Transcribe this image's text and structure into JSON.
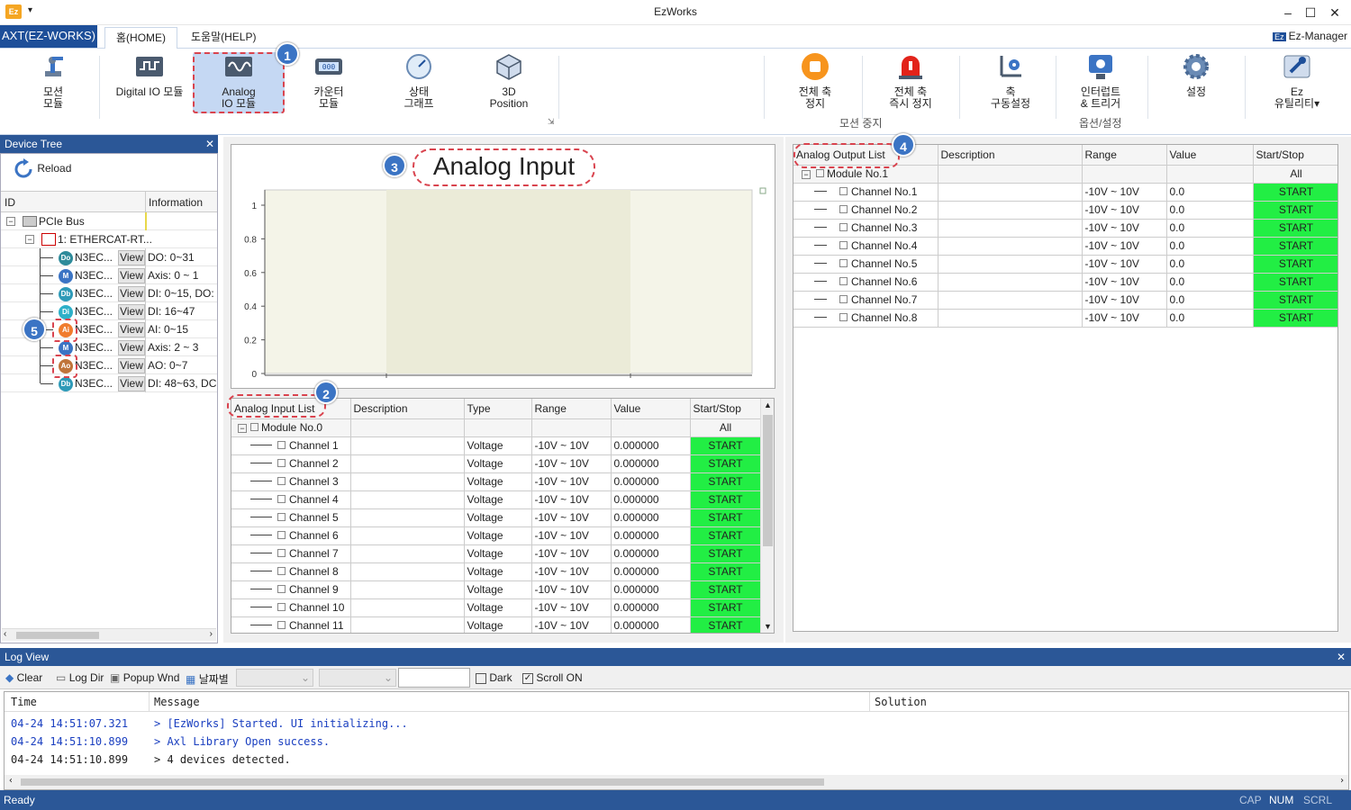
{
  "window": {
    "title": "EzWorks",
    "app_logo": "Ez"
  },
  "menu": {
    "app_button": "AXT(EZ-WORKS)",
    "tabs": [
      "홈(HOME)",
      "도움말(HELP)"
    ],
    "ez_manager": "Ez-Manager"
  },
  "ribbon": {
    "buttons": [
      {
        "label1": "모션",
        "label2": "모듈",
        "icon": "robot-arm-icon"
      },
      {
        "label1": "Digital IO 모듈",
        "label2": "",
        "icon": "digital-io-icon"
      },
      {
        "label1": "Analog",
        "label2": "IO 모듈",
        "icon": "analog-io-icon"
      },
      {
        "label1": "카운터",
        "label2": "모듈",
        "icon": "counter-icon"
      },
      {
        "label1": "상태",
        "label2": "그래프",
        "icon": "gauge-icon"
      },
      {
        "label1": "3D",
        "label2": "Position",
        "icon": "cube-icon"
      },
      {
        "label1": "전체 축",
        "label2": "정지",
        "icon": "stop-icon"
      },
      {
        "label1": "전체 축",
        "label2": "즉시 정지",
        "icon": "alarm-icon"
      },
      {
        "label1": "축",
        "label2": "구동설정",
        "icon": "axis-settings-icon"
      },
      {
        "label1": "인터럽트",
        "label2": "& 트리거",
        "icon": "interrupt-icon"
      },
      {
        "label1": "설정",
        "label2": "",
        "icon": "gear-icon"
      },
      {
        "label1": "Ez",
        "label2": "유틸리티",
        "icon": "wrench-icon"
      }
    ],
    "groups": [
      "모션 중지",
      "옵션/설정"
    ]
  },
  "callouts": [
    "1",
    "2",
    "3",
    "4",
    "5"
  ],
  "device_tree": {
    "title": "Device Tree",
    "reload": "Reload",
    "columns": [
      "ID",
      "Information"
    ],
    "root": "PCIe Bus",
    "master": "1: ETHERCAT-RT...",
    "view_label": "View",
    "nodes": [
      {
        "icon": "Do",
        "color": "#2e8b9a",
        "name": "N3EC...",
        "info": "DO: 0~31"
      },
      {
        "icon": "M",
        "color": "#3b74c4",
        "name": "N3EC...",
        "info": "Axis: 0 ~ 1"
      },
      {
        "icon": "Db",
        "color": "#2e9ab8",
        "name": "N3EC...",
        "info": "DI: 0~15, DO:"
      },
      {
        "icon": "Di",
        "color": "#2eb0c8",
        "name": "N3EC...",
        "info": "DI: 16~47"
      },
      {
        "icon": "Ai",
        "color": "#f07c2e",
        "name": "N3EC...",
        "info": "AI: 0~15"
      },
      {
        "icon": "M",
        "color": "#3b74c4",
        "name": "N3EC...",
        "info": "Axis: 2 ~ 3"
      },
      {
        "icon": "Ao",
        "color": "#c0743a",
        "name": "N3EC...",
        "info": "AO: 0~7"
      },
      {
        "icon": "Db",
        "color": "#2e9ab8",
        "name": "N3EC...",
        "info": "DI: 48~63, DC"
      }
    ]
  },
  "chart": {
    "title": "Analog Input",
    "y_ticks": [
      "1",
      "0.8",
      "0.6",
      "0.4",
      "0.2",
      "0"
    ]
  },
  "ai_table": {
    "columns": [
      "Analog Input List",
      "Description",
      "Type",
      "Range",
      "Value",
      "Start/Stop"
    ],
    "module": "Module No.0",
    "all_label": "All",
    "rows": [
      {
        "name": "Channel 1",
        "type": "Voltage",
        "range": "-10V ~ 10V",
        "value": "0.000000",
        "action": "START"
      },
      {
        "name": "Channel 2",
        "type": "Voltage",
        "range": "-10V ~ 10V",
        "value": "0.000000",
        "action": "START"
      },
      {
        "name": "Channel 3",
        "type": "Voltage",
        "range": "-10V ~ 10V",
        "value": "0.000000",
        "action": "START"
      },
      {
        "name": "Channel 4",
        "type": "Voltage",
        "range": "-10V ~ 10V",
        "value": "0.000000",
        "action": "START"
      },
      {
        "name": "Channel 5",
        "type": "Voltage",
        "range": "-10V ~ 10V",
        "value": "0.000000",
        "action": "START"
      },
      {
        "name": "Channel 6",
        "type": "Voltage",
        "range": "-10V ~ 10V",
        "value": "0.000000",
        "action": "START"
      },
      {
        "name": "Channel 7",
        "type": "Voltage",
        "range": "-10V ~ 10V",
        "value": "0.000000",
        "action": "START"
      },
      {
        "name": "Channel 8",
        "type": "Voltage",
        "range": "-10V ~ 10V",
        "value": "0.000000",
        "action": "START"
      },
      {
        "name": "Channel 9",
        "type": "Voltage",
        "range": "-10V ~ 10V",
        "value": "0.000000",
        "action": "START"
      },
      {
        "name": "Channel 10",
        "type": "Voltage",
        "range": "-10V ~ 10V",
        "value": "0.000000",
        "action": "START"
      },
      {
        "name": "Channel 11",
        "type": "Voltage",
        "range": "-10V ~ 10V",
        "value": "0.000000",
        "action": "START"
      }
    ]
  },
  "ao_table": {
    "columns": [
      "Analog Output List",
      "Description",
      "Range",
      "Value",
      "Start/Stop"
    ],
    "module": "Module No.1",
    "all_label": "All",
    "rows": [
      {
        "name": "Channel No.1",
        "range": "-10V ~ 10V",
        "value": "0.0",
        "action": "START"
      },
      {
        "name": "Channel No.2",
        "range": "-10V ~ 10V",
        "value": "0.0",
        "action": "START"
      },
      {
        "name": "Channel No.3",
        "range": "-10V ~ 10V",
        "value": "0.0",
        "action": "START"
      },
      {
        "name": "Channel No.4",
        "range": "-10V ~ 10V",
        "value": "0.0",
        "action": "START"
      },
      {
        "name": "Channel No.5",
        "range": "-10V ~ 10V",
        "value": "0.0",
        "action": "START"
      },
      {
        "name": "Channel No.6",
        "range": "-10V ~ 10V",
        "value": "0.0",
        "action": "START"
      },
      {
        "name": "Channel No.7",
        "range": "-10V ~ 10V",
        "value": "0.0",
        "action": "START"
      },
      {
        "name": "Channel No.8",
        "range": "-10V ~ 10V",
        "value": "0.0",
        "action": "START"
      }
    ]
  },
  "log": {
    "title": "Log View",
    "toolbar": {
      "clear": "Clear",
      "log_dir": "Log Dir",
      "popup": "Popup Wnd",
      "date": "날짜별",
      "dark": "Dark",
      "scroll": "Scroll ON"
    },
    "columns": [
      "Time",
      "Message",
      "Solution"
    ],
    "entries": [
      {
        "time": "04-24 14:51:07.321",
        "message": "> [EzWorks] Started. UI initializing...",
        "color": "#1a3fc0"
      },
      {
        "time": "04-24 14:51:10.899",
        "message": "> Axl Library Open success.",
        "color": "#1a3fc0"
      },
      {
        "time": "04-24 14:51:10.899",
        "message": "> 4 devices detected.",
        "color": "#222222"
      }
    ]
  },
  "status": {
    "left": "Ready",
    "caps": "CAP",
    "num": "NUM",
    "scrl": "SCRL"
  }
}
